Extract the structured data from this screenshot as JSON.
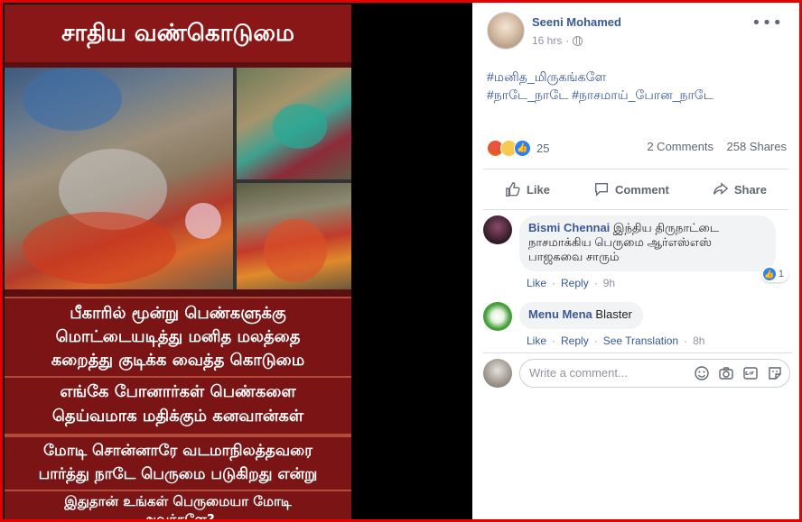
{
  "poster": {
    "title": "சாதிய வண்கொடுமை",
    "line1a": "பீகாரில் மூன்று பெண்களுக்கு",
    "line1b": "மொட்டையடித்து மனித மலத்தை",
    "line1c": "கறைத்து குடிக்க வைத்த கொடுமை",
    "line2a": "எங்கே போனார்கள் பெண்களை",
    "line2b": "தெய்வமாக மதிக்கும் கனவான்கள்",
    "line3a": "மோடி சொன்னாரே வடமாநிலத்தவரை",
    "line3b": "பார்த்து நாடே பெருமை படுகிறது என்று",
    "line4a": "இதுதான் உங்கள் பெருமையா மோடி",
    "line4b": "அவர்களே?"
  },
  "post": {
    "author": "Seeni Mohamed",
    "time": "16 hrs",
    "more": "•••",
    "tags_line1": "#மனித_மிருகங்களே",
    "tags_line2": "#நாடே_நாடே #நாசமாய்_போன_நாடே",
    "reactions_count": "25",
    "comments_count": "2 Comments",
    "shares_count": "258 Shares"
  },
  "actions": {
    "like": "Like",
    "comment": "Comment",
    "share": "Share"
  },
  "comments": [
    {
      "name": "Bismi Chennai",
      "text": "இந்திய திருநாட்டை நாசமாக்கிய பெருமை ஆர்எஸ்எஸ் பாஜகவை சாரும்",
      "like": "Like",
      "reply": "Reply",
      "time": "9h",
      "likes": "1"
    },
    {
      "name": "Menu Mena",
      "text": "Blaster",
      "like": "Like",
      "reply": "Reply",
      "translate": "See Translation",
      "time": "8h"
    }
  ],
  "composer": {
    "placeholder": "Write a comment..."
  },
  "colors": {
    "link": "#385898",
    "border": "#e60000",
    "poster_red": "#7b1414"
  }
}
